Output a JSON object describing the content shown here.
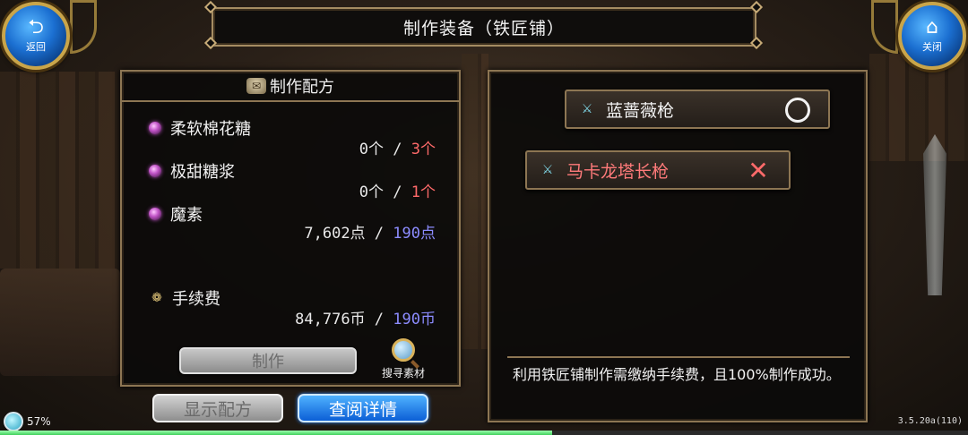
{
  "header": {
    "back_button": {
      "label": "返回",
      "icon": "back-arrow-icon"
    },
    "close_button": {
      "label": "关闭",
      "icon": "home-icon"
    },
    "title": "制作装备（铁匠铺）"
  },
  "recipe_panel": {
    "title": "制作配方",
    "materials": [
      {
        "name": "柔软棉花糖",
        "owned": "0个",
        "sep": " / ",
        "required": "3个"
      },
      {
        "name": "极甜糖浆",
        "owned": "0个",
        "sep": " / ",
        "required": "1个"
      },
      {
        "name": "魔素",
        "owned": "7,602点",
        "sep": " / ",
        "required": "190点"
      }
    ],
    "fee": {
      "name": "手续费",
      "owned": "84,776币",
      "sep": " / ",
      "required": "190币"
    },
    "make_button": "制作",
    "search_materials": "搜寻素材"
  },
  "bottom_buttons": {
    "show_recipe": "显示配方",
    "view_details": "查阅详情"
  },
  "result_panel": {
    "items": [
      {
        "name": "蓝蔷薇枪",
        "status": "available",
        "name_color": "#f2f2f2"
      },
      {
        "name": "马卡龙塔长枪",
        "status": "unavailable",
        "name_color": "#ff7a7a"
      }
    ],
    "description": "利用铁匠铺制作需缴纳手续费，且100%制作成功。"
  },
  "status_bar": {
    "battery": "57%",
    "battery_level": 0.57,
    "version": "3.5.20a(110)"
  },
  "colors": {
    "required_short": "#ff6a6a",
    "required_ok": "#8c8cff",
    "accent_blue": "#1b6fd1",
    "frame_gold": "#8d7653"
  }
}
